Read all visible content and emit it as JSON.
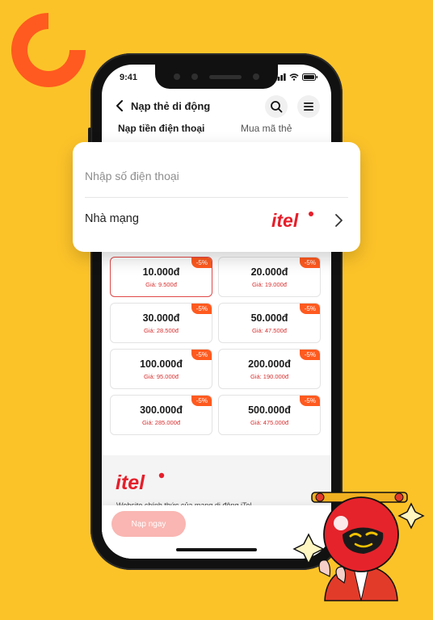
{
  "status_bar": {
    "time": "9:41"
  },
  "header": {
    "title": "Nạp thẻ di động"
  },
  "tabs": [
    {
      "label": "Nạp tiền điện thoại",
      "active": true
    },
    {
      "label": "Mua mã thẻ",
      "active": false
    }
  ],
  "form": {
    "phone_placeholder": "Nhập số điện thoại",
    "carrier_label": "Nhà mạng",
    "carrier_logo_text": "itel"
  },
  "price_options": [
    {
      "amount": "10.000đ",
      "price": "Giá: 9.500đ",
      "discount": "-5%",
      "selected": true
    },
    {
      "amount": "20.000đ",
      "price": "Giá: 19.000đ",
      "discount": "-5%",
      "selected": false
    },
    {
      "amount": "30.000đ",
      "price": "Giá: 28.500đ",
      "discount": "-5%",
      "selected": false
    },
    {
      "amount": "50.000đ",
      "price": "Giá: 47.500đ",
      "discount": "-5%",
      "selected": false
    },
    {
      "amount": "100.000đ",
      "price": "Giá: 95.000đ",
      "discount": "-5%",
      "selected": false
    },
    {
      "amount": "200.000đ",
      "price": "Giá: 190.000đ",
      "discount": "-5%",
      "selected": false
    },
    {
      "amount": "300.000đ",
      "price": "Giá: 285.000đ",
      "discount": "-5%",
      "selected": false
    },
    {
      "amount": "500.000đ",
      "price": "Giá: 475.000đ",
      "discount": "-5%",
      "selected": false
    }
  ],
  "info": {
    "brand": "itel",
    "text": "Website chính thức của mạng di động iTel"
  },
  "bottom": {
    "submit_label": "Nạp ngay"
  },
  "icons": {
    "logo": "quarter-circle-logo-icon",
    "back": "chevron-left-icon",
    "search": "search-icon",
    "menu": "hamburger-menu-icon",
    "chevron": "chevron-right-icon",
    "mascot": "mascot-character"
  },
  "colors": {
    "background": "#FCC329",
    "brand_orange": "#FF5A1F",
    "itel_red": "#E61E2A",
    "price_red": "#D93030",
    "button_disabled": "#F9B6B2"
  }
}
